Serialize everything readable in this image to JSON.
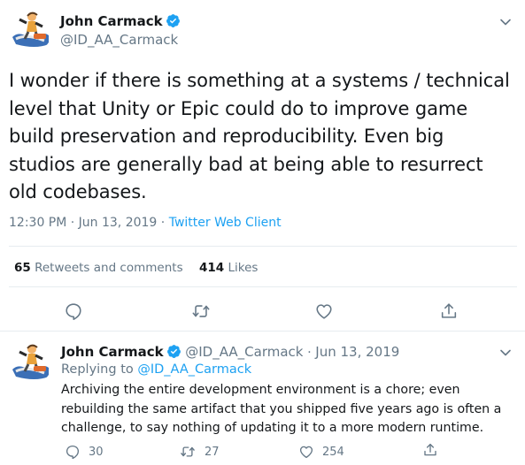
{
  "main_tweet": {
    "author_name": "John Carmack",
    "author_handle": "@ID_AA_Carmack",
    "text": "I wonder if there is something at a systems / technical level that Unity or Epic could do to improve game build preservation and reproducibility. Even big studios are generally bad at being able to resurrect old codebases.",
    "timestamp": "12:30 PM · Jun 13, 2019",
    "separator": "·",
    "source": "Twitter Web Client",
    "retweets_count": "65",
    "retweets_label": "Retweets and comments",
    "likes_count": "414",
    "likes_label": "Likes"
  },
  "reply_tweet": {
    "author_name": "John Carmack",
    "author_handle": "@ID_AA_Carmack",
    "separator": "·",
    "date": "Jun 13, 2019",
    "replying_to_label": "Replying to",
    "replying_to_handle": "@ID_AA_Carmack",
    "text": "Archiving the entire development environment is a chore; even rebuilding the same artifact that you shipped five years ago is often a challenge, to say nothing of updating it to a more modern runtime.",
    "reply_count": "30",
    "retweet_count": "27",
    "like_count": "254"
  },
  "colors": {
    "accent": "#1da1f2",
    "text": "#14171a",
    "secondary": "#657786",
    "divider": "#e6ecf0"
  },
  "icons": {
    "verified": "verified-badge-icon",
    "more": "chevron-down-icon",
    "reply": "reply-icon",
    "retweet": "retweet-icon",
    "like": "heart-icon",
    "share": "share-icon"
  }
}
